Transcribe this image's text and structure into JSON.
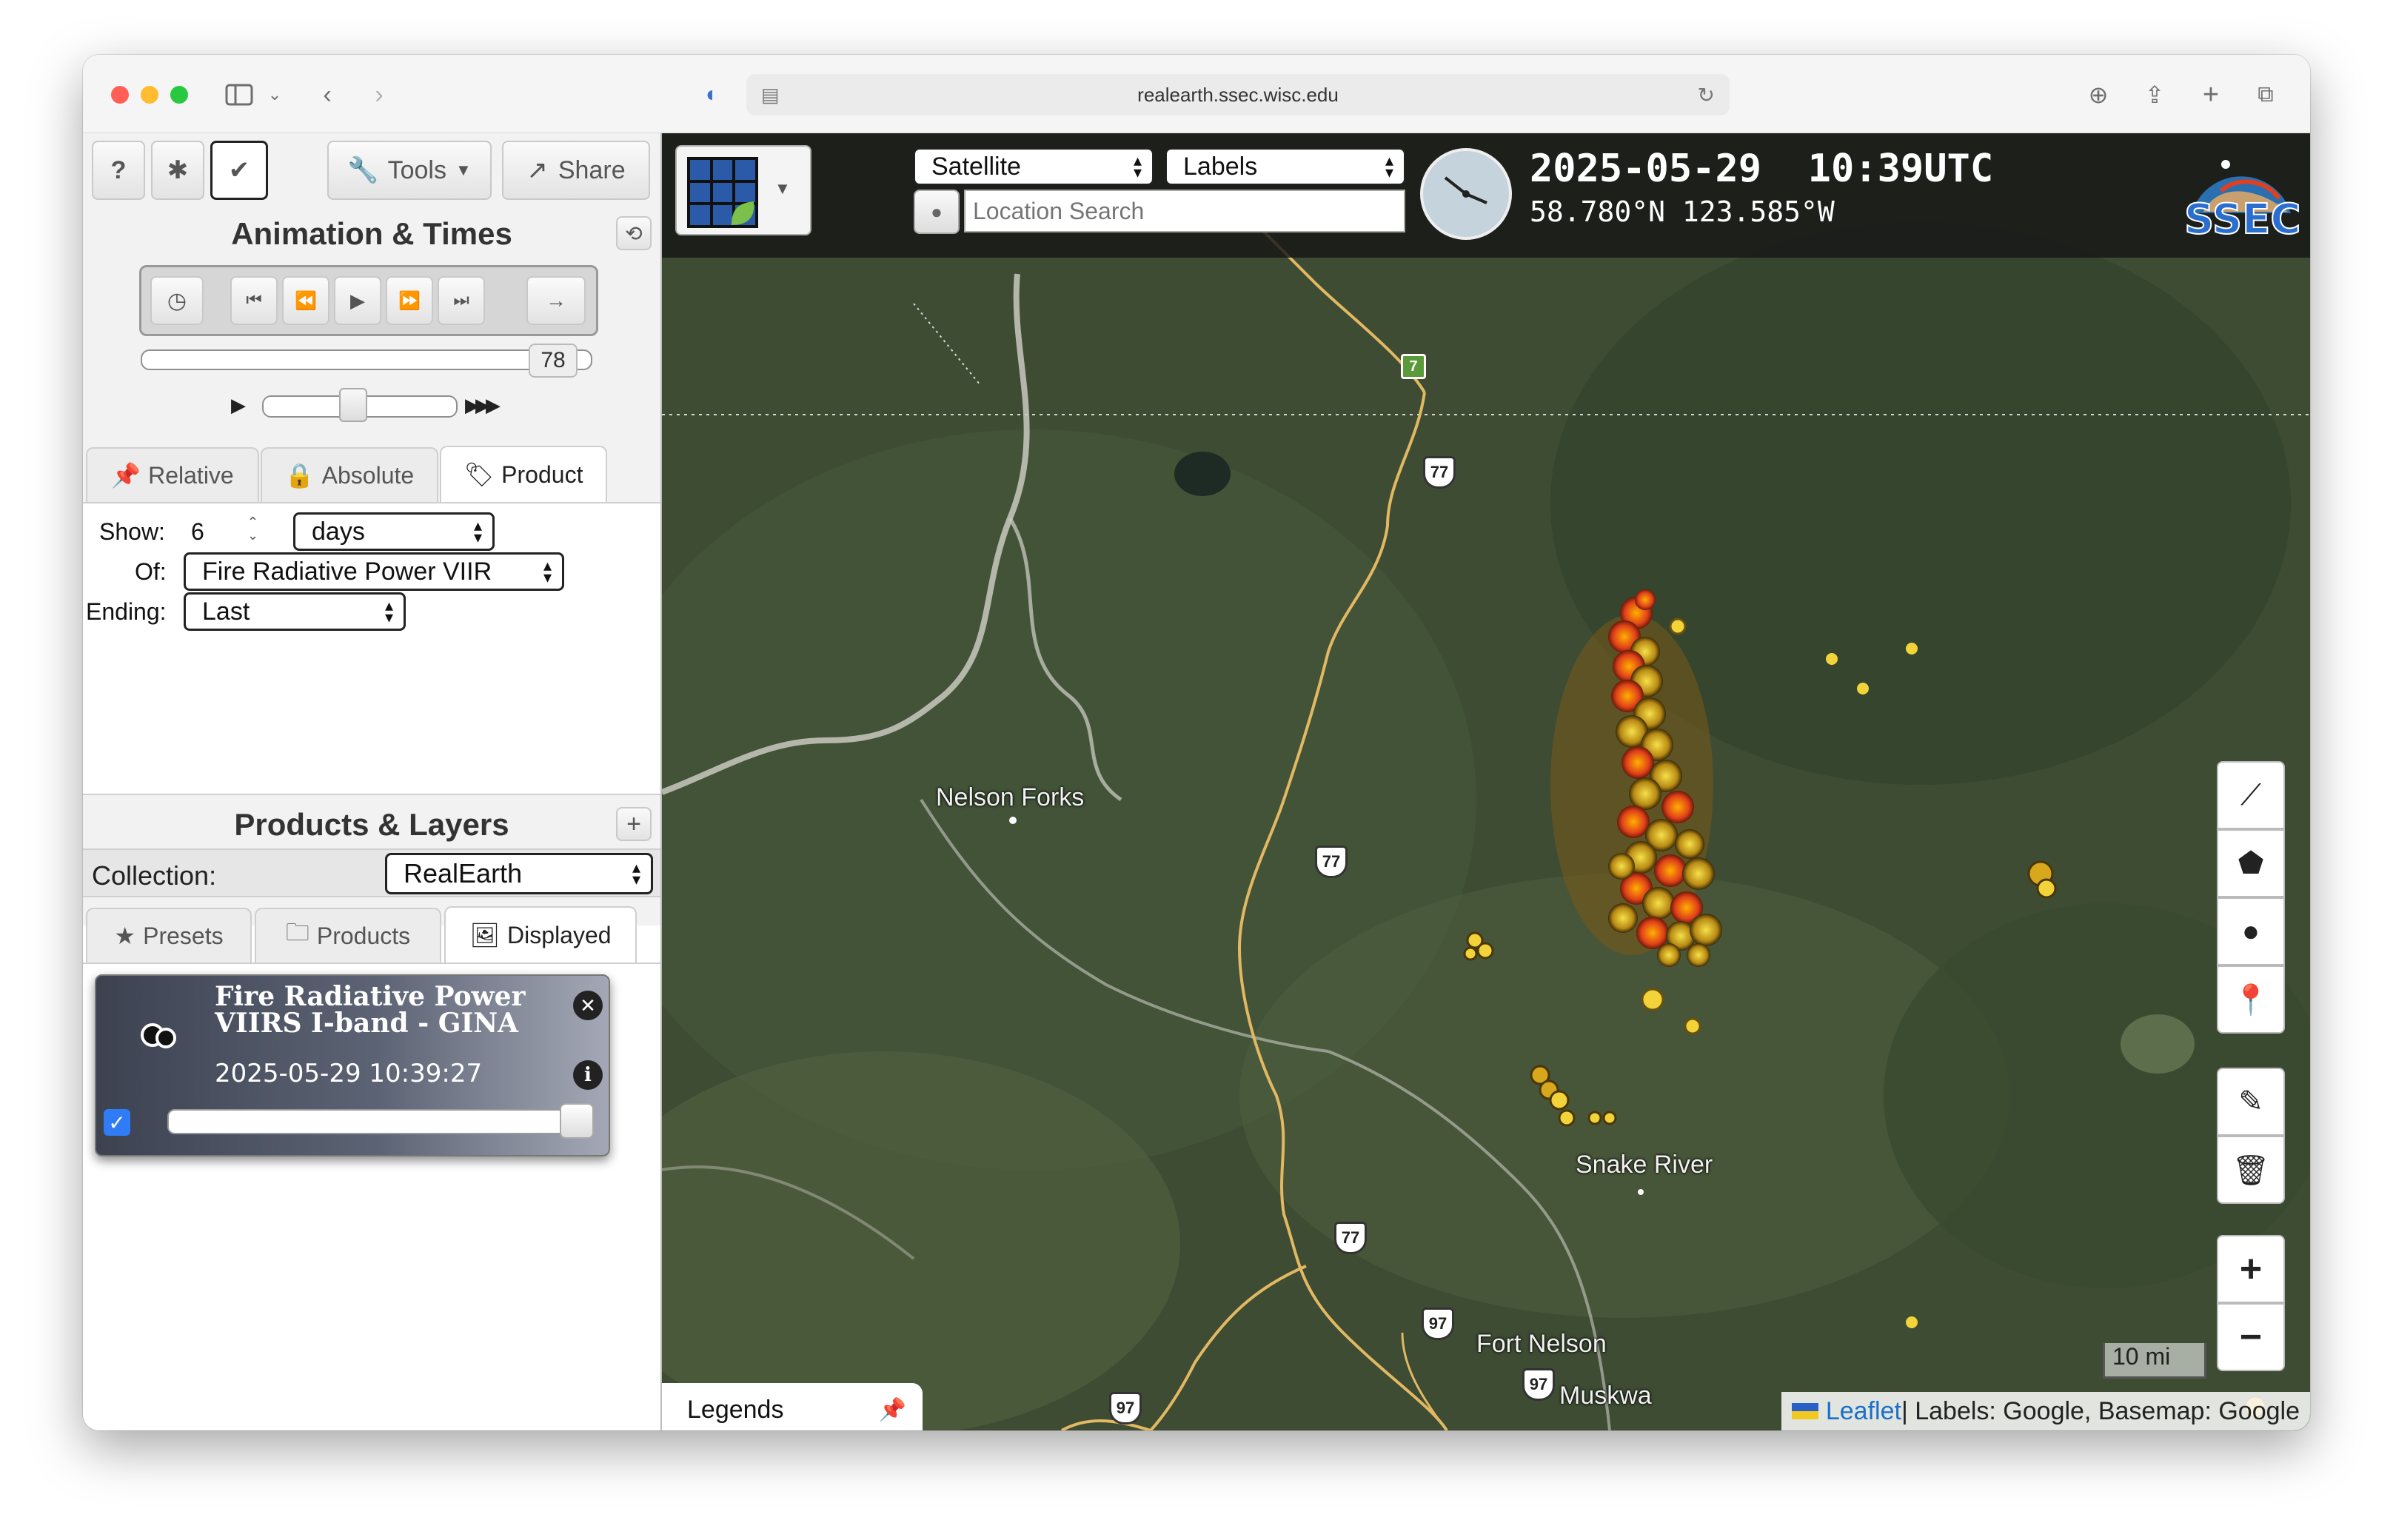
{
  "browser": {
    "url": "realearth.ssec.wisc.edu"
  },
  "toolbar": {
    "help_label": "?",
    "tools_label": "Tools",
    "share_label": "Share"
  },
  "animation": {
    "title": "Animation & Times",
    "frame_count": "78",
    "tabs": [
      "Relative",
      "Absolute",
      "Product"
    ],
    "active_tab": "Product",
    "show_label": "Show:",
    "show_value": "6",
    "show_unit": "days",
    "of_label": "Of:",
    "of_value": "Fire Radiative Power VIIR",
    "ending_label": "Ending:",
    "ending_value": "Last"
  },
  "layers": {
    "title": "Products & Layers",
    "collection_label": "Collection:",
    "collection_value": "RealEarth",
    "tabs": [
      "Presets",
      "Products",
      "Displayed"
    ],
    "active_tab": "Displayed",
    "card": {
      "title_line1": "Fire Radiative Power",
      "title_line2": "VIIRS I-band - GINA",
      "timestamp": "2025-05-29 10:39:27",
      "visible": true,
      "opacity": 1.0
    }
  },
  "map": {
    "basemap_select": "Satellite",
    "labels_select": "Labels",
    "search_placeholder": "Location Search",
    "datetime": "2025-05-29  10:39UTC",
    "coords": "58.780°N 123.585°W",
    "logo_text": "SSEC",
    "places": [
      "Nelson Forks",
      "Snake River",
      "Fort Nelson",
      "Muskwa"
    ],
    "highway_labels": [
      "7",
      "77",
      "77",
      "77",
      "97",
      "97",
      "97"
    ],
    "scale": "10 mi",
    "legends_label": "Legends",
    "attribution_link": "Leaflet",
    "attribution_text": " | Labels: Google, Basemap: Google",
    "zoom_in": "+",
    "zoom_out": "−",
    "colors": {
      "fire_hot": "#e0401a",
      "fire_mid": "#d8a81c",
      "fire_low": "#f2d43a",
      "header_bg": "#1a1a1a",
      "link": "#1a6fc9"
    }
  }
}
